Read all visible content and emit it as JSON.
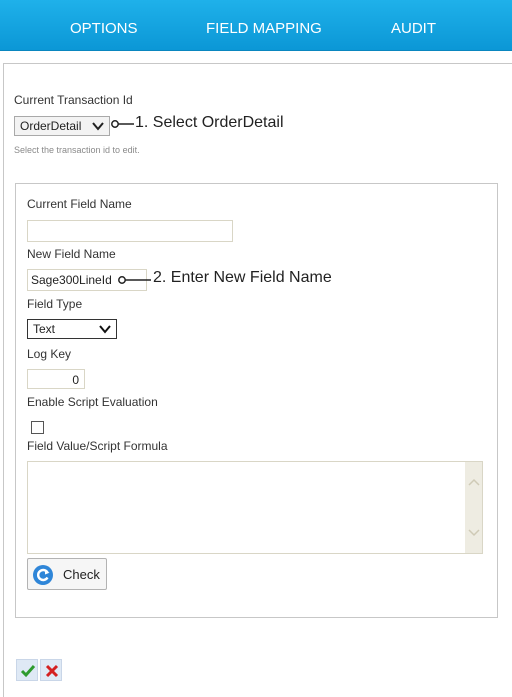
{
  "nav": {
    "tabs": [
      "OPTIONS",
      "FIELD MAPPING",
      "AUDIT"
    ]
  },
  "form": {
    "current_transaction_label": "Current Transaction Id",
    "transaction_selected": "OrderDetail",
    "transaction_hint": "Select the transaction id to edit.",
    "annotation_1": "1. Select OrderDetail",
    "current_field_label": "Current Field Name",
    "current_field_value": "",
    "new_field_label": "New Field Name",
    "new_field_value": "Sage300LineId",
    "annotation_2": "2. Enter New Field Name",
    "field_type_label": "Field Type",
    "field_type_selected": "Text",
    "log_key_label": "Log Key",
    "log_key_value": "0",
    "enable_script_label": "Enable Script Evaluation",
    "script_formula_label": "Field Value/Script Formula",
    "check_button_label": "Check"
  },
  "colors": {
    "nav_bg": "#0ea3e0",
    "accent_blue": "#2f86d8",
    "ok_green": "#2e9b2e",
    "cancel_red": "#d42020"
  },
  "icons": {
    "ok": "checkmark-icon",
    "cancel": "x-icon",
    "check": "refresh-check-icon"
  }
}
